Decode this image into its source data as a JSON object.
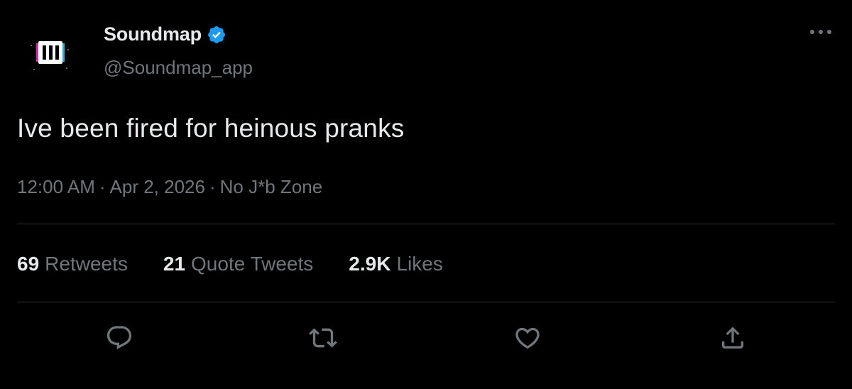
{
  "tweet": {
    "display_name": "Soundmap",
    "handle": "@Soundmap_app",
    "text": "Ive been fired for heinous pranks",
    "time": "12:00 AM",
    "date": "Apr 2, 2026",
    "location": "No J*b Zone",
    "separator": "·"
  },
  "stats": {
    "retweets_count": "69",
    "retweets_label": "Retweets",
    "quotes_count": "21",
    "quotes_label": "Quote Tweets",
    "likes_count": "2.9K",
    "likes_label": "Likes"
  },
  "icons": {
    "avatar": "soundmap-logo-icon",
    "verified": "verified-badge-icon",
    "more": "more-options-icon",
    "reply": "reply-icon",
    "retweet": "retweet-icon",
    "like": "heart-icon",
    "share": "share-icon"
  },
  "colors": {
    "background": "#000000",
    "primary_text": "#e7e9ea",
    "secondary_text": "#71767b",
    "divider": "#2f3336",
    "verified_blue": "#1d9bf0"
  }
}
